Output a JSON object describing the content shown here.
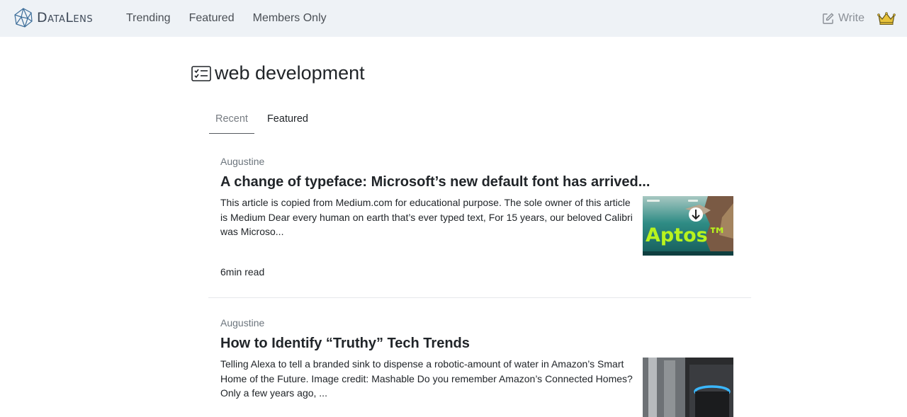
{
  "navbar": {
    "brand": "DataLens",
    "links": [
      "Trending",
      "Featured",
      "Members Only"
    ],
    "write_label": "Write"
  },
  "topic": {
    "title": "web development"
  },
  "tabs": [
    {
      "label": "Recent",
      "active": true
    },
    {
      "label": "Featured",
      "active": false
    }
  ],
  "articles": [
    {
      "author": "Augustine",
      "title": "A change of typeface: Microsoft’s new default font has arrived...",
      "excerpt": "This article is copied from Medium.com for educational purpose. The sole owner of this article is Medium Dear every human on earth that’s ever typed text, For 15 years, our beloved Calibri was Microso...",
      "read_time": "6min read",
      "thumbnail_text": "Aptos™"
    },
    {
      "author": "Augustine",
      "title": "How to Identify “Truthy” Tech Trends",
      "excerpt": "Telling Alexa to tell a branded sink to dispense a robotic-amount of water in Amazon’s Smart Home of the Future. Image credit: Mashable Do you remember Amazon’s Connected Homes? Only a few years ago, ..."
    }
  ],
  "colors": {
    "navbar_bg": "#eef2f6",
    "crown": "#e8c33c",
    "thumb_text": "#b8f31e"
  }
}
